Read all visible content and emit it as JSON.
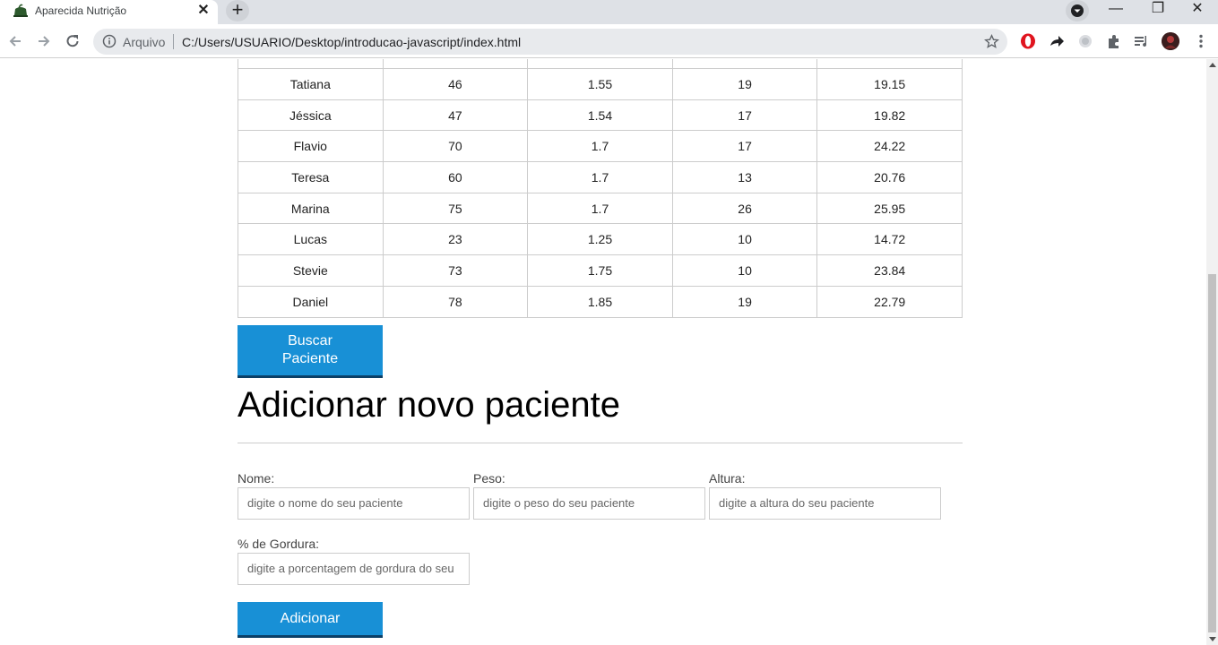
{
  "browser": {
    "tab_title": "Aparecida Nutrição",
    "tab_close": "✕",
    "new_tab": "+",
    "window_controls": {
      "minimize": "—",
      "restore": "❐",
      "close": "✕"
    },
    "address": {
      "security_label": "Arquivo",
      "url": "C:/Users/USUARIO/Desktop/introducao-javascript/index.html"
    },
    "icons": [
      "back-arrow-icon",
      "forward-arrow-icon",
      "reload-icon",
      "info-icon",
      "star-icon",
      "opera-icon",
      "share-arrow-icon",
      "record-icon",
      "extensions-puzzle-icon",
      "media-queue-icon",
      "profile-avatar",
      "menu-kebab-icon"
    ]
  },
  "table": {
    "rows": [
      {
        "nome": "Tatiana",
        "peso": "46",
        "altura": "1.55",
        "gordura": "19",
        "imc": "19.15"
      },
      {
        "nome": "Jéssica",
        "peso": "47",
        "altura": "1.54",
        "gordura": "17",
        "imc": "19.82"
      },
      {
        "nome": "Flavio",
        "peso": "70",
        "altura": "1.7",
        "gordura": "17",
        "imc": "24.22"
      },
      {
        "nome": "Teresa",
        "peso": "60",
        "altura": "1.7",
        "gordura": "13",
        "imc": "20.76"
      },
      {
        "nome": "Marina",
        "peso": "75",
        "altura": "1.7",
        "gordura": "26",
        "imc": "25.95"
      },
      {
        "nome": "Lucas",
        "peso": "23",
        "altura": "1.25",
        "gordura": "10",
        "imc": "14.72"
      },
      {
        "nome": "Stevie",
        "peso": "73",
        "altura": "1.75",
        "gordura": "10",
        "imc": "23.84"
      },
      {
        "nome": "Daniel",
        "peso": "78",
        "altura": "1.85",
        "gordura": "19",
        "imc": "22.79"
      }
    ]
  },
  "search_button": {
    "line1": "Buscar",
    "line2": "Paciente"
  },
  "form": {
    "title": "Adicionar novo paciente",
    "nome": {
      "label": "Nome:",
      "placeholder": "digite o nome do seu paciente"
    },
    "peso": {
      "label": "Peso:",
      "placeholder": "digite o peso do seu paciente"
    },
    "altura": {
      "label": "Altura:",
      "placeholder": "digite a altura do seu paciente"
    },
    "gordura": {
      "label": "% de Gordura:",
      "placeholder": "digite a porcentagem de gordura do seu"
    },
    "submit_label": "Adicionar"
  },
  "colors": {
    "button_bg": "#1890d6",
    "button_border": "#0b3f66"
  }
}
